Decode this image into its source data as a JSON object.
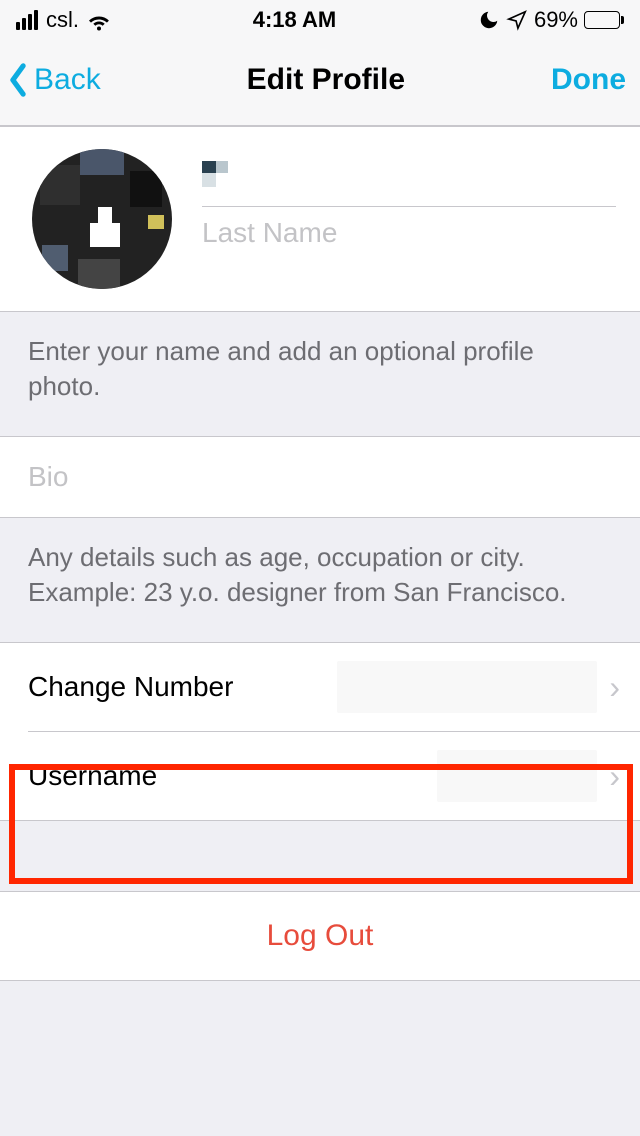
{
  "status": {
    "carrier": "csl.",
    "time": "4:18 AM",
    "battery_pct": "69%"
  },
  "nav": {
    "back_label": "Back",
    "title": "Edit Profile",
    "done_label": "Done"
  },
  "profile": {
    "first_name_value": "",
    "last_name_value": "",
    "last_name_placeholder": "Last Name",
    "footer": "Enter your name and add an optional profile photo."
  },
  "bio": {
    "value": "",
    "placeholder": "Bio",
    "footer": "Any details such as age, occupation or city. Example: 23 y.o. designer from San Francisco."
  },
  "rows": {
    "change_number_label": "Change Number",
    "username_label": "Username"
  },
  "logout_label": "Log Out"
}
